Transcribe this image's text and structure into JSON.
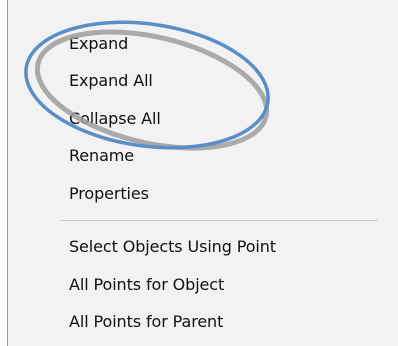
{
  "context_menu": {
    "items": [
      {
        "label": "Expand"
      },
      {
        "label": "Expand All"
      },
      {
        "label": "Collapse All"
      },
      {
        "label": "Rename"
      },
      {
        "label": "Properties"
      }
    ],
    "items_after_separator": [
      {
        "label": "Select Objects Using Point"
      },
      {
        "label": "All Points for Object"
      },
      {
        "label": "All Points for Parent"
      }
    ]
  },
  "annotation": {
    "ellipse_color_primary": "#5b8ec7",
    "ellipse_color_secondary": "#9e9e9e"
  },
  "colors": {
    "menu_background": "#f2f2f2",
    "text": "#111111",
    "separator": "#c9c9c9"
  }
}
